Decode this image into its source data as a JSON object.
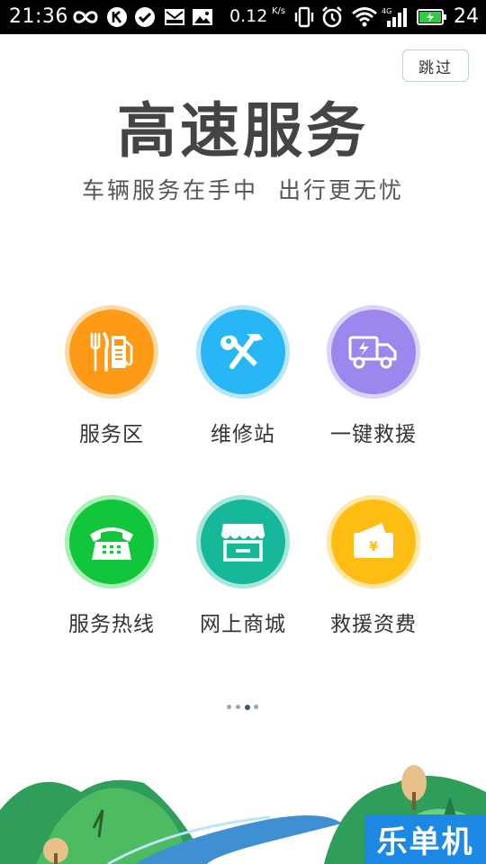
{
  "status_bar": {
    "time": "21:36",
    "network_speed": "0.12",
    "network_speed_unit": "K/s",
    "battery_level": "24",
    "icons": [
      "infinity-icon",
      "k-badge-icon",
      "check-circle-icon",
      "mail-icon",
      "image-icon",
      "vibrate-icon",
      "alarm-icon",
      "wifi-icon",
      "signal-4g-icon",
      "battery-charging-icon"
    ]
  },
  "skip_button": {
    "label": "跳过"
  },
  "hero": {
    "title": "高速服务",
    "subtitle": "车辆服务在手中  出行更无忧"
  },
  "services": [
    {
      "label": "服务区",
      "icon": "fuel-dining-icon",
      "color": "#ff9a16",
      "ring": "#ffd9a6"
    },
    {
      "label": "维修站",
      "icon": "repair-tools-icon",
      "color": "#27b6f6",
      "ring": "#b7e7fb"
    },
    {
      "label": "一键救援",
      "icon": "tow-truck-icon",
      "color": "#9d87ee",
      "ring": "#dcd3f8"
    },
    {
      "label": "服务热线",
      "icon": "telephone-icon",
      "color": "#11c63a",
      "ring": "#a9efb8"
    },
    {
      "label": "网上商城",
      "icon": "storefront-icon",
      "color": "#17b89a",
      "ring": "#a7e7da"
    },
    {
      "label": "救援资费",
      "icon": "wallet-yuan-icon",
      "color": "#ffbd14",
      "ring": "#ffe7a6"
    }
  ],
  "pagination": {
    "total": 3,
    "active": 2
  },
  "watermark": {
    "text": "乐单机"
  },
  "colors": {
    "title": "#444444",
    "hill_dark": "#2f9e5a",
    "hill_light": "#6fcf7c",
    "road": "#3f8fd3"
  }
}
